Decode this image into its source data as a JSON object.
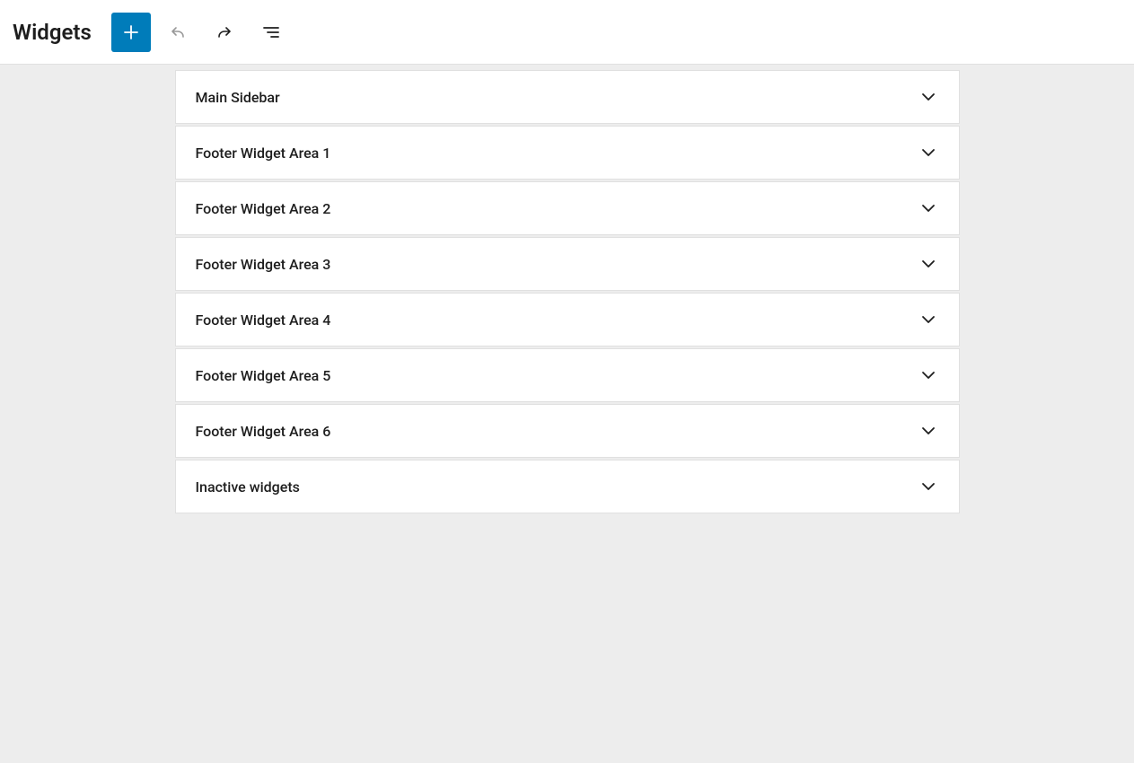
{
  "header": {
    "title": "Widgets"
  },
  "widgetAreas": [
    {
      "label": "Main Sidebar"
    },
    {
      "label": "Footer Widget Area 1"
    },
    {
      "label": "Footer Widget Area 2"
    },
    {
      "label": "Footer Widget Area 3"
    },
    {
      "label": "Footer Widget Area 4"
    },
    {
      "label": "Footer Widget Area 5"
    },
    {
      "label": "Footer Widget Area 6"
    },
    {
      "label": "Inactive widgets"
    }
  ]
}
